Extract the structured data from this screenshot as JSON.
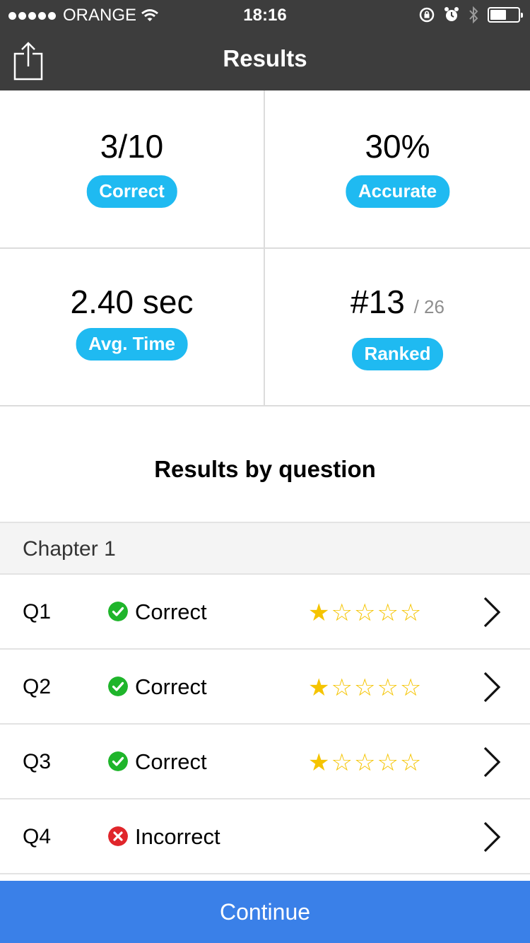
{
  "status_bar": {
    "carrier": "ORANGE",
    "time": "18:16"
  },
  "nav": {
    "title": "Results"
  },
  "stats": {
    "correct": {
      "value": "3/10",
      "label": "Correct"
    },
    "accurate": {
      "value": "30%",
      "label": "Accurate"
    },
    "avg_time": {
      "value": "2.40 sec",
      "label": "Avg. Time"
    },
    "ranked": {
      "value": "#13",
      "total": "/ 26",
      "label": "Ranked"
    }
  },
  "section": {
    "title": "Results by question"
  },
  "chapter": {
    "title": "Chapter 1"
  },
  "questions": [
    {
      "id": "Q1",
      "status": "Correct",
      "stars": "★☆☆☆☆",
      "rating": 1
    },
    {
      "id": "Q2",
      "status": "Correct",
      "stars": "★☆☆☆☆",
      "rating": 1
    },
    {
      "id": "Q3",
      "status": "Correct",
      "stars": "★☆☆☆☆",
      "rating": 1
    },
    {
      "id": "Q4",
      "status": "Incorrect",
      "stars": "",
      "rating": 0
    }
  ],
  "footer": {
    "continue_label": "Continue"
  },
  "colors": {
    "pill": "#1fbaf1",
    "correct": "#1fb52b",
    "incorrect": "#e0262b",
    "star": "#f5c400",
    "continue": "#3a80e8",
    "topbar": "#3d3d3d"
  }
}
